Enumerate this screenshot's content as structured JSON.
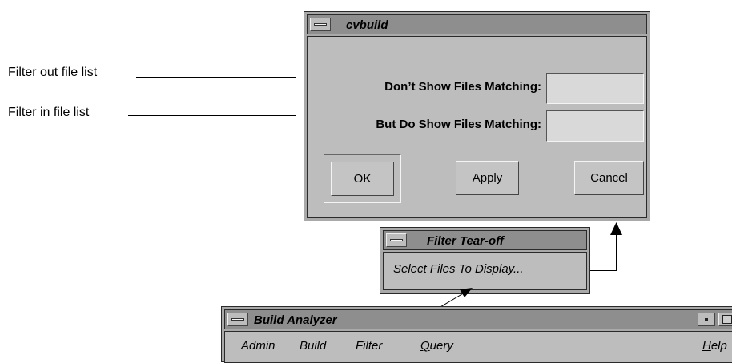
{
  "callouts": {
    "filter_out": "Filter out file list",
    "filter_in": "Filter in file list"
  },
  "cvbuild_dialog": {
    "title": "cvbuild",
    "dont_show_label": "Don’t Show Files Matching:",
    "dont_show_value": "",
    "do_show_label": "But Do Show Files Matching:",
    "do_show_value": "",
    "ok_label": "OK",
    "apply_label": "Apply",
    "cancel_label": "Cancel"
  },
  "tearoff": {
    "title": "Filter Tear-off",
    "item_label": "Select Files To Display..."
  },
  "build_analyzer": {
    "title": "Build Analyzer",
    "menus": [
      {
        "label": "Admin",
        "mnemonic": ""
      },
      {
        "label": "Build",
        "mnemonic": ""
      },
      {
        "label": "Filter",
        "mnemonic": ""
      },
      {
        "label": "Query",
        "mnemonic": "Q",
        "rest": "uery"
      },
      {
        "label": "Help",
        "mnemonic": "H",
        "rest": "elp"
      }
    ]
  },
  "icons": {
    "window_menu": "window-menu-icon",
    "minimize": "minimize-icon",
    "maximize": "maximize-icon"
  }
}
